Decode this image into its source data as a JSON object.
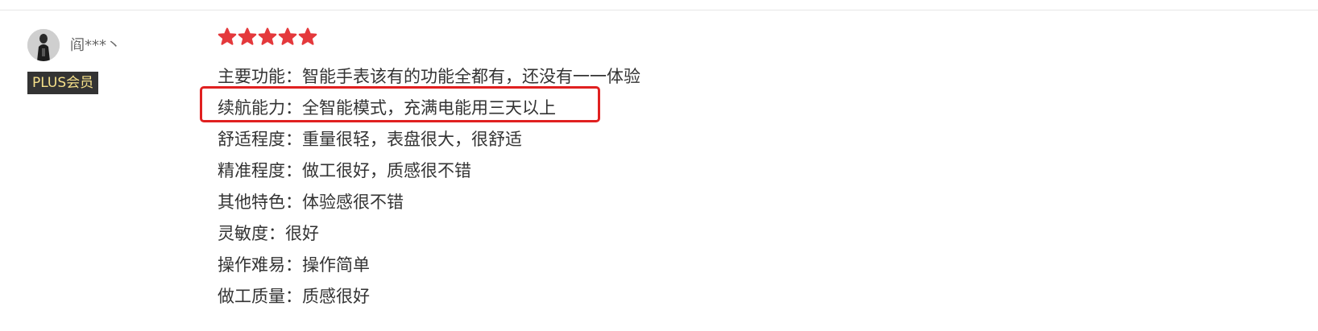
{
  "reviewer": {
    "name": "阎***丶",
    "badge": "PLUS会员",
    "avatar_icon": "avatar-icon"
  },
  "rating": {
    "stars": 5,
    "max": 5,
    "star_color": "#e4393c",
    "star_icon": "star-icon"
  },
  "review_lines": [
    "主要功能：智能手表该有的功能全都有，还没有一一体验",
    "续航能力：全智能模式，充满电能用三天以上",
    "舒适程度：重量很轻，表盘很大，很舒适",
    "精准程度：做工很好，质感很不错",
    "其他特色：体验感很不错",
    "灵敏度：很好",
    "操作难易：操作简单",
    "做工质量：质感很好"
  ],
  "highlight": {
    "line_index": 1,
    "color": "#e02020"
  },
  "colors": {
    "badge_bg": "#333333",
    "badge_text": "#f5e08a",
    "text": "#333333",
    "username": "#666666"
  }
}
